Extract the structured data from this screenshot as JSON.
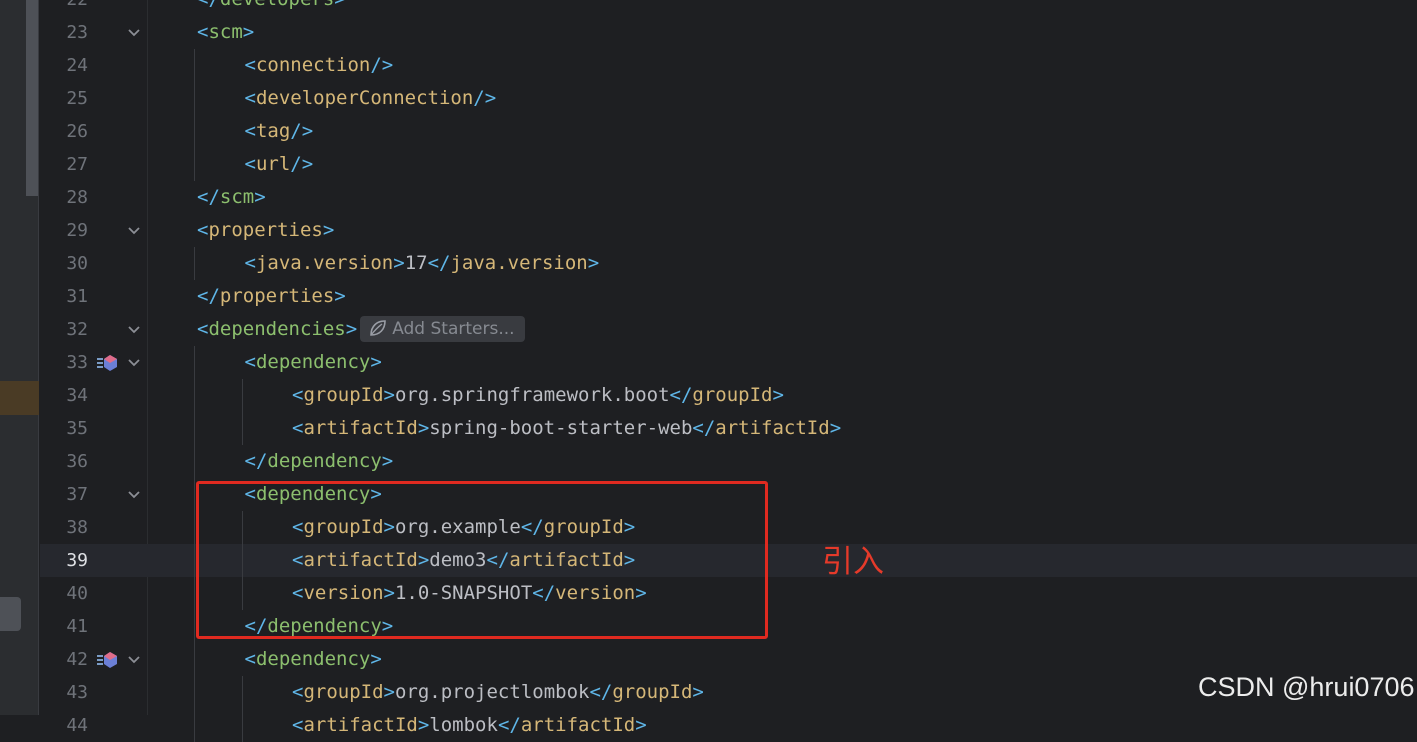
{
  "editor": {
    "language": "xml",
    "current_line": 39,
    "lines": [
      {
        "num": "22",
        "indent": 1,
        "fold": false,
        "marker": false,
        "tokens": [
          [
            "</",
            "b"
          ],
          [
            "developers",
            "g"
          ],
          [
            ">",
            "b"
          ]
        ]
      },
      {
        "num": "23",
        "indent": 1,
        "fold": true,
        "marker": false,
        "tokens": [
          [
            "<",
            "b"
          ],
          [
            "scm",
            "g"
          ],
          [
            ">",
            "b"
          ]
        ]
      },
      {
        "num": "24",
        "indent": 2,
        "fold": false,
        "marker": false,
        "tokens": [
          [
            "<",
            "b"
          ],
          [
            "connection",
            "y"
          ],
          [
            "/>",
            "b"
          ]
        ]
      },
      {
        "num": "25",
        "indent": 2,
        "fold": false,
        "marker": false,
        "tokens": [
          [
            "<",
            "b"
          ],
          [
            "developerConnection",
            "y"
          ],
          [
            "/>",
            "b"
          ]
        ]
      },
      {
        "num": "26",
        "indent": 2,
        "fold": false,
        "marker": false,
        "tokens": [
          [
            "<",
            "b"
          ],
          [
            "tag",
            "y"
          ],
          [
            "/>",
            "b"
          ]
        ]
      },
      {
        "num": "27",
        "indent": 2,
        "fold": false,
        "marker": false,
        "tokens": [
          [
            "<",
            "b"
          ],
          [
            "url",
            "y"
          ],
          [
            "/>",
            "b"
          ]
        ]
      },
      {
        "num": "28",
        "indent": 1,
        "fold": false,
        "marker": false,
        "tokens": [
          [
            "</",
            "b"
          ],
          [
            "scm",
            "g"
          ],
          [
            ">",
            "b"
          ]
        ]
      },
      {
        "num": "29",
        "indent": 1,
        "fold": true,
        "marker": false,
        "tokens": [
          [
            "<",
            "b"
          ],
          [
            "properties",
            "y"
          ],
          [
            ">",
            "b"
          ]
        ]
      },
      {
        "num": "30",
        "indent": 2,
        "fold": false,
        "marker": false,
        "tokens": [
          [
            "<",
            "b"
          ],
          [
            "java.version",
            "y"
          ],
          [
            ">",
            "b"
          ],
          [
            "17",
            "t"
          ],
          [
            "</",
            "b"
          ],
          [
            "java.version",
            "y"
          ],
          [
            ">",
            "b"
          ]
        ]
      },
      {
        "num": "31",
        "indent": 1,
        "fold": false,
        "marker": false,
        "tokens": [
          [
            "</",
            "b"
          ],
          [
            "properties",
            "y"
          ],
          [
            ">",
            "b"
          ]
        ]
      },
      {
        "num": "32",
        "indent": 1,
        "fold": true,
        "marker": false,
        "tokens": [
          [
            "<",
            "b"
          ],
          [
            "dependencies",
            "g"
          ],
          [
            ">",
            "b"
          ]
        ],
        "hint": "Add Starters..."
      },
      {
        "num": "33",
        "indent": 2,
        "fold": true,
        "marker": true,
        "tokens": [
          [
            "<",
            "b"
          ],
          [
            "dependency",
            "g"
          ],
          [
            ">",
            "b"
          ]
        ]
      },
      {
        "num": "34",
        "indent": 3,
        "fold": false,
        "marker": false,
        "tokens": [
          [
            "<",
            "b"
          ],
          [
            "groupId",
            "y"
          ],
          [
            ">",
            "b"
          ],
          [
            "org.springframework.boot",
            "t"
          ],
          [
            "</",
            "b"
          ],
          [
            "groupId",
            "y"
          ],
          [
            ">",
            "b"
          ]
        ]
      },
      {
        "num": "35",
        "indent": 3,
        "fold": false,
        "marker": false,
        "tokens": [
          [
            "<",
            "b"
          ],
          [
            "artifactId",
            "y"
          ],
          [
            ">",
            "b"
          ],
          [
            "spring-boot-starter-web",
            "t"
          ],
          [
            "</",
            "b"
          ],
          [
            "artifactId",
            "y"
          ],
          [
            ">",
            "b"
          ]
        ]
      },
      {
        "num": "36",
        "indent": 2,
        "fold": false,
        "marker": false,
        "tokens": [
          [
            "</",
            "b"
          ],
          [
            "dependency",
            "g"
          ],
          [
            ">",
            "b"
          ]
        ]
      },
      {
        "num": "37",
        "indent": 2,
        "fold": true,
        "marker": false,
        "tokens": [
          [
            "<",
            "b"
          ],
          [
            "dependency",
            "g"
          ],
          [
            ">",
            "b"
          ]
        ]
      },
      {
        "num": "38",
        "indent": 3,
        "fold": false,
        "marker": false,
        "tokens": [
          [
            "<",
            "b"
          ],
          [
            "groupId",
            "y"
          ],
          [
            ">",
            "b"
          ],
          [
            "org.example",
            "t"
          ],
          [
            "</",
            "b"
          ],
          [
            "groupId",
            "y"
          ],
          [
            ">",
            "b"
          ]
        ]
      },
      {
        "num": "39",
        "indent": 3,
        "fold": false,
        "marker": false,
        "tokens": [
          [
            "<",
            "b"
          ],
          [
            "artifactId",
            "y"
          ],
          [
            ">",
            "b"
          ],
          [
            "demo3",
            "t"
          ],
          [
            "</",
            "b"
          ],
          [
            "artifactId",
            "y"
          ],
          [
            ">",
            "b"
          ]
        ]
      },
      {
        "num": "40",
        "indent": 3,
        "fold": false,
        "marker": false,
        "tokens": [
          [
            "<",
            "b"
          ],
          [
            "version",
            "y"
          ],
          [
            ">",
            "b"
          ],
          [
            "1.0-SNAPSHOT",
            "t"
          ],
          [
            "</",
            "b"
          ],
          [
            "version",
            "y"
          ],
          [
            ">",
            "b"
          ]
        ]
      },
      {
        "num": "41",
        "indent": 2,
        "fold": false,
        "marker": false,
        "tokens": [
          [
            "</",
            "b"
          ],
          [
            "dependency",
            "g"
          ],
          [
            ">",
            "b"
          ]
        ]
      },
      {
        "num": "42",
        "indent": 2,
        "fold": true,
        "marker": true,
        "tokens": [
          [
            "<",
            "b"
          ],
          [
            "dependency",
            "g"
          ],
          [
            ">",
            "b"
          ]
        ]
      },
      {
        "num": "43",
        "indent": 3,
        "fold": false,
        "marker": false,
        "tokens": [
          [
            "<",
            "b"
          ],
          [
            "groupId",
            "y"
          ],
          [
            ">",
            "b"
          ],
          [
            "org.projectlombok",
            "t"
          ],
          [
            "</",
            "b"
          ],
          [
            "groupId",
            "y"
          ],
          [
            ">",
            "b"
          ]
        ]
      },
      {
        "num": "44",
        "indent": 3,
        "fold": false,
        "marker": false,
        "tokens": [
          [
            "<",
            "b"
          ],
          [
            "artifactId",
            "y"
          ],
          [
            ">",
            "b"
          ],
          [
            "lombok",
            "t"
          ],
          [
            "</",
            "b"
          ],
          [
            "artifactId",
            "y"
          ],
          [
            ">",
            "b"
          ]
        ]
      }
    ]
  },
  "annotation": {
    "label": "引入",
    "color": "#e02a20"
  },
  "watermark": "CSDN @hrui0706",
  "colors": {
    "background": "#1e1f22",
    "bracket": "#5fb6e8",
    "tag_green": "#8cbf6e",
    "tag_gold": "#d5b778",
    "text": "#bcbec4",
    "line_number": "#6f737a"
  },
  "icons": {
    "fold": "chevron-down-icon",
    "gutter_marker": "maven-dependency-icon",
    "hint": "spring-leaf-icon"
  }
}
